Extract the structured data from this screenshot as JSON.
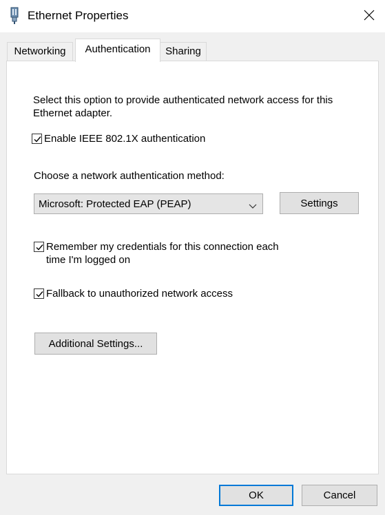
{
  "window": {
    "title": "Ethernet Properties",
    "close_symbol": "✕"
  },
  "tabs": [
    {
      "label": "Networking"
    },
    {
      "label": "Authentication"
    },
    {
      "label": "Sharing"
    }
  ],
  "authentication": {
    "description": "Select this option to provide authenticated network access for this Ethernet adapter.",
    "enable_8021x": {
      "label": "Enable IEEE 802.1X authentication",
      "checked": true
    },
    "method_label": "Choose a network authentication method:",
    "method_select": {
      "value": "Microsoft: Protected EAP (PEAP)"
    },
    "settings_button": "Settings",
    "remember_credentials": {
      "label": "Remember my credentials for this connection each time I'm logged on",
      "checked": true
    },
    "fallback": {
      "label": "Fallback to unauthorized network access",
      "checked": true
    },
    "additional_settings_button": "Additional Settings..."
  },
  "footer": {
    "ok_button": "OK",
    "cancel_button": "Cancel"
  },
  "colors": {
    "accent": "#0078d7",
    "panel_background": "#ffffff",
    "dialog_background": "#f0f0f0"
  }
}
